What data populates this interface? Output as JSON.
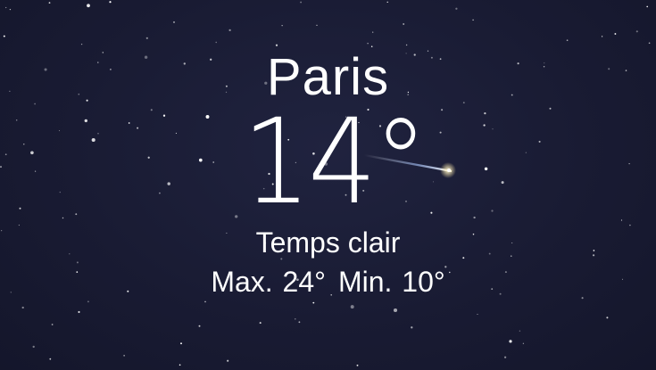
{
  "weather": {
    "city": "Paris",
    "temperature": "14°",
    "condition": "Temps clair",
    "high": "Max. 24°",
    "low": "Min. 10°"
  },
  "colors": {
    "sky": "#191b33",
    "text": "#ffffff"
  },
  "icons": {
    "shooting_star": "shooting-star-icon"
  }
}
